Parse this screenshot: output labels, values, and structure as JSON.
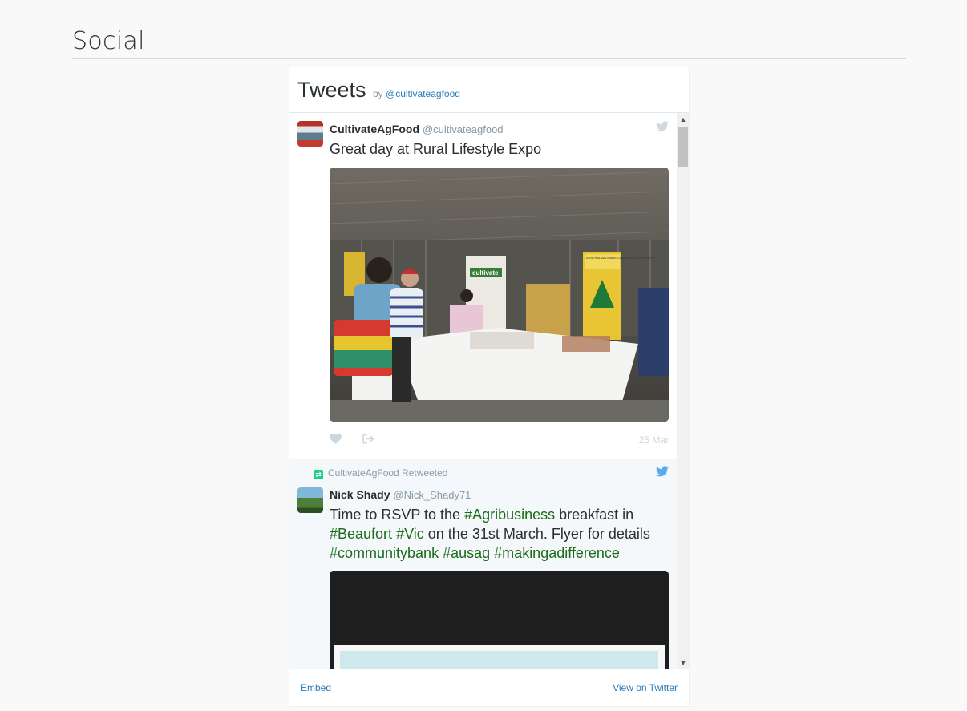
{
  "section": {
    "title": "Social"
  },
  "widget": {
    "title": "Tweets",
    "by_prefix": "by",
    "by_handle": "@cultivateagfood",
    "footer": {
      "embed": "Embed",
      "view_on_twitter": "View on Twitter"
    }
  },
  "tweets": [
    {
      "name": "CultivateAgFood",
      "handle": "@cultivateagfood",
      "text": "Great day at Rural Lifestyle Expo",
      "date": "25 Mar",
      "photo": {
        "sign_cultivate": "cultivate",
        "sign_australian_made": "AUSTRALIAN MADE CAMPAIGN SUPPORTER"
      }
    },
    {
      "retweeted_by": "CultivateAgFood Retweeted",
      "name": "Nick Shady",
      "handle": "@Nick_Shady71",
      "text": {
        "p1": "Time to RSVP to the ",
        "tag1": "#Agribusiness",
        "p2": " breakfast in ",
        "tag2": "#Beaufort",
        "tag3": "#Vic",
        "p3": " on the 31st March. Flyer for details ",
        "tag4": "#communitybank",
        "tag5": "#ausag",
        "tag6": "#makingadifference"
      }
    }
  ],
  "colors": {
    "link": "#2b7bb9",
    "hashtag": "#1a6b1a",
    "twitter_blue": "#55acee",
    "retweet_green": "#19cf86"
  },
  "icons": [
    "twitter-bird-icon",
    "heart-icon",
    "share-icon",
    "retweet-icon",
    "scroll-up-icon",
    "scroll-down-icon"
  ]
}
